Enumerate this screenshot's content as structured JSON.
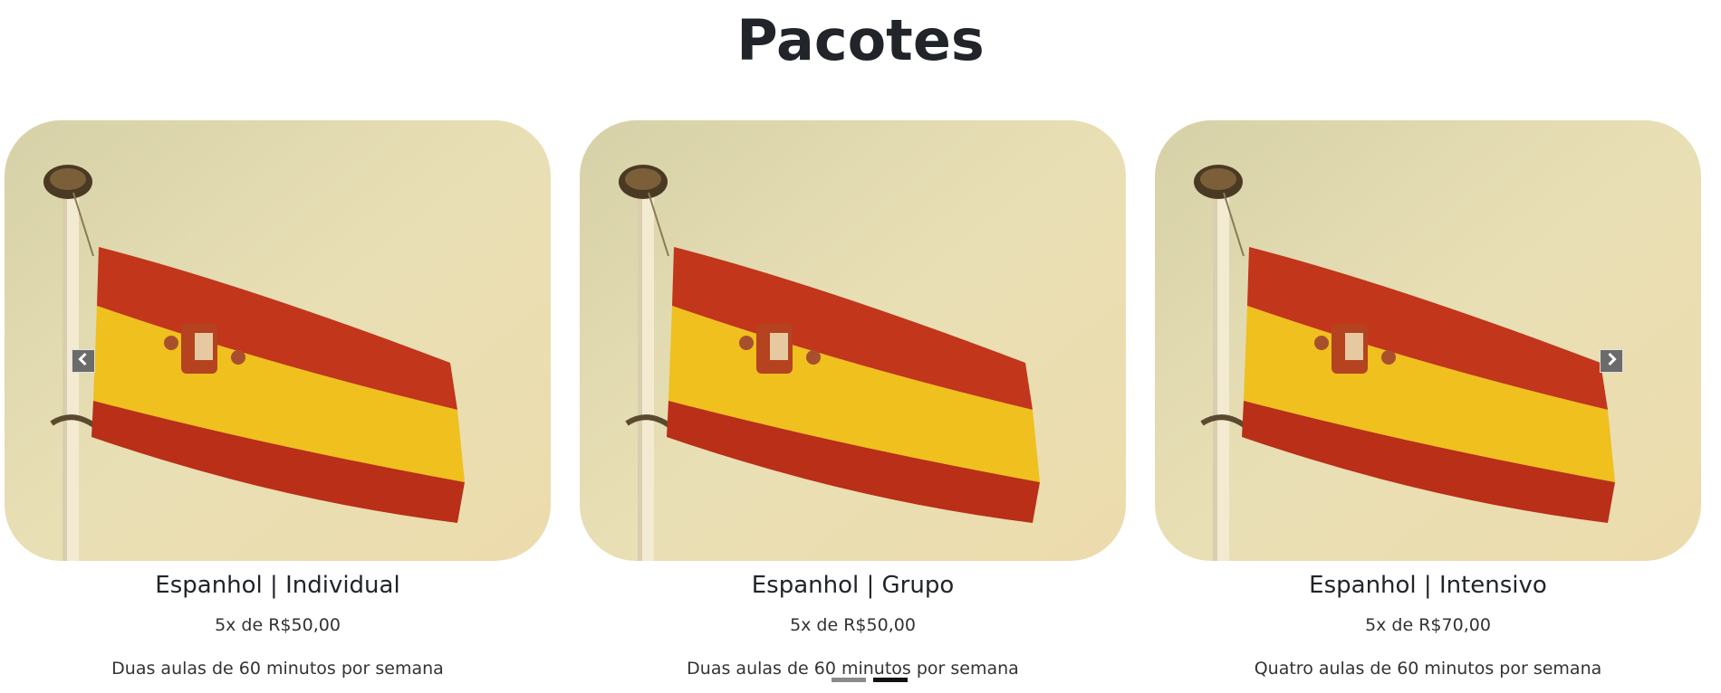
{
  "section": {
    "title": "Pacotes"
  },
  "carousel": {
    "prev_icon": "chevron-left-icon",
    "next_icon": "chevron-right-icon",
    "indicator_count": 2,
    "active_indicator": 1,
    "cards": [
      {
        "title": "Espanhol | Individual",
        "price": "5x de R$50,00",
        "description": "Duas aulas de 60 minutos por semana",
        "image": "spain-flag-image"
      },
      {
        "title": "Espanhol | Grupo",
        "price": "5x de R$50,00",
        "description": "Duas aulas de 60 minutos por semana",
        "image": "spain-flag-image"
      },
      {
        "title": "Espanhol | Intensivo",
        "price": "5x de R$70,00",
        "description": "Quatro aulas de 60 minutos por semana",
        "image": "spain-flag-image"
      }
    ]
  },
  "colors": {
    "flag_red": "#c2361b",
    "flag_yellow": "#efc01e",
    "sky": "#e8dcae",
    "arrow_bg": "#6b6b6b"
  }
}
